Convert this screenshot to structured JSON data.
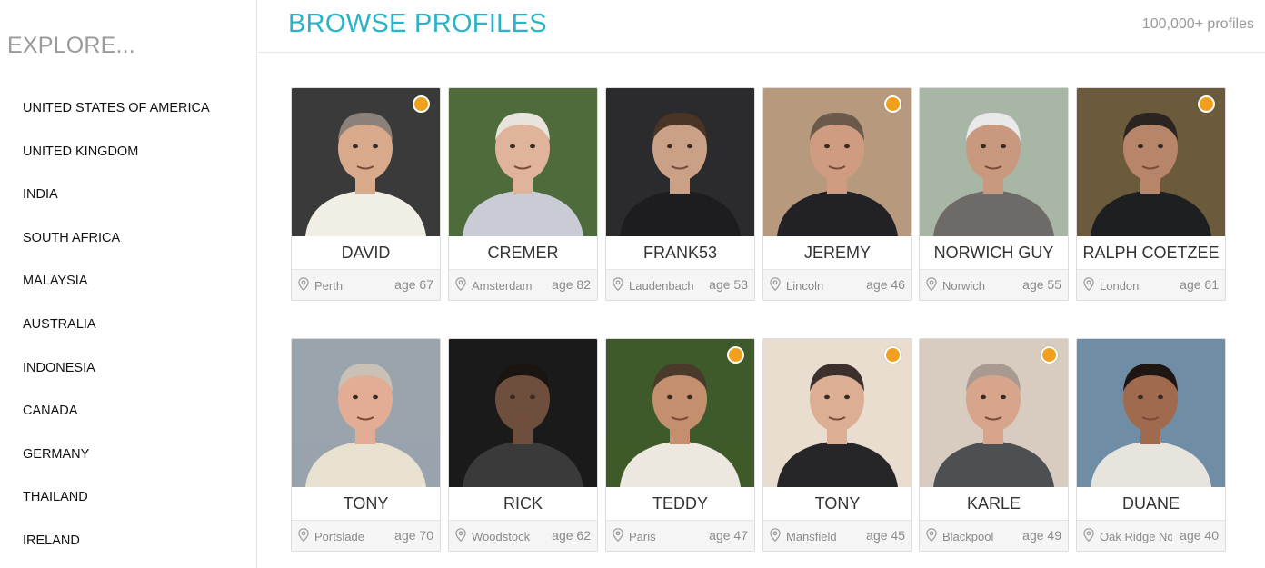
{
  "sidebar": {
    "heading": "EXPLORE...",
    "countries": [
      "UNITED STATES OF AMERICA",
      "UNITED KINGDOM",
      "INDIA",
      "SOUTH AFRICA",
      "MALAYSIA",
      "AUSTRALIA",
      "INDONESIA",
      "CANADA",
      "GERMANY",
      "THAILAND",
      "IRELAND"
    ]
  },
  "header": {
    "title": "BROWSE PROFILES",
    "count": "100,000+ profiles"
  },
  "colors": {
    "accent": "#28b3c9",
    "online": "#f0a01e"
  },
  "profiles": [
    {
      "name": "DAVID",
      "city": "Perth",
      "age": "age 67",
      "online": true,
      "bg": "#3a3a3a",
      "skin": "#d9a98c",
      "shirt": "#f1eee6",
      "hair": "#8b8178"
    },
    {
      "name": "CREMER",
      "city": "Amsterdam",
      "age": "age 82",
      "online": false,
      "bg": "#4f6b3c",
      "skin": "#e0b39b",
      "shirt": "#c9ccd4",
      "hair": "#e8e3dc"
    },
    {
      "name": "FRANK53",
      "city": "Laudenbach",
      "age": "age 53",
      "online": false,
      "bg": "#2b2b2d",
      "skin": "#caa087",
      "shirt": "#1d1d1f",
      "hair": "#4a3426"
    },
    {
      "name": "JEREMY",
      "city": "Lincoln",
      "age": "age 46",
      "online": true,
      "bg": "#b79a7e",
      "skin": "#cf9c82",
      "shirt": "#222226",
      "hair": "#6b5a4c"
    },
    {
      "name": "NORWICH GUY",
      "city": "Norwich",
      "age": "age 55",
      "online": false,
      "bg": "#a8b6a6",
      "skin": "#c9997f",
      "shirt": "#6d6a68",
      "hair": "#e9e9ea"
    },
    {
      "name": "RALPH COETZEE",
      "city": "London",
      "age": "age 61",
      "online": true,
      "bg": "#6b5a3c",
      "skin": "#b7856a",
      "shirt": "#1e1f20",
      "hair": "#2b2421"
    },
    {
      "name": "TONY",
      "city": "Portslade",
      "age": "age 70",
      "online": false,
      "bg": "#9aa4ad",
      "skin": "#e2ad94",
      "shirt": "#e9e1cf",
      "hair": "#c9c1b6"
    },
    {
      "name": "RICK",
      "city": "Woodstock",
      "age": "age 62",
      "online": false,
      "bg": "#1a1a1a",
      "skin": "#6e4f3e",
      "shirt": "#3a3a3a",
      "hair": "#1b1512"
    },
    {
      "name": "TEDDY",
      "city": "Paris",
      "age": "age 47",
      "online": true,
      "bg": "#3f5a2a",
      "skin": "#c48f6e",
      "shirt": "#ece8df",
      "hair": "#4a3a2c"
    },
    {
      "name": "TONY",
      "city": "Mansfield",
      "age": "age 45",
      "online": true,
      "bg": "#e9ddd0",
      "skin": "#dcae93",
      "shirt": "#262628",
      "hair": "#3b302b"
    },
    {
      "name": "KARLE",
      "city": "Blackpool",
      "age": "age 49",
      "online": true,
      "bg": "#d8ccc0",
      "skin": "#d6a58c",
      "shirt": "#4d5052",
      "hair": "#a89a90"
    },
    {
      "name": "DUANE",
      "city": "Oak Ridge North",
      "age": "age 40",
      "online": false,
      "bg": "#6f8ea6",
      "skin": "#a06a4e",
      "shirt": "#e7e4de",
      "hair": "#1d1614"
    }
  ]
}
